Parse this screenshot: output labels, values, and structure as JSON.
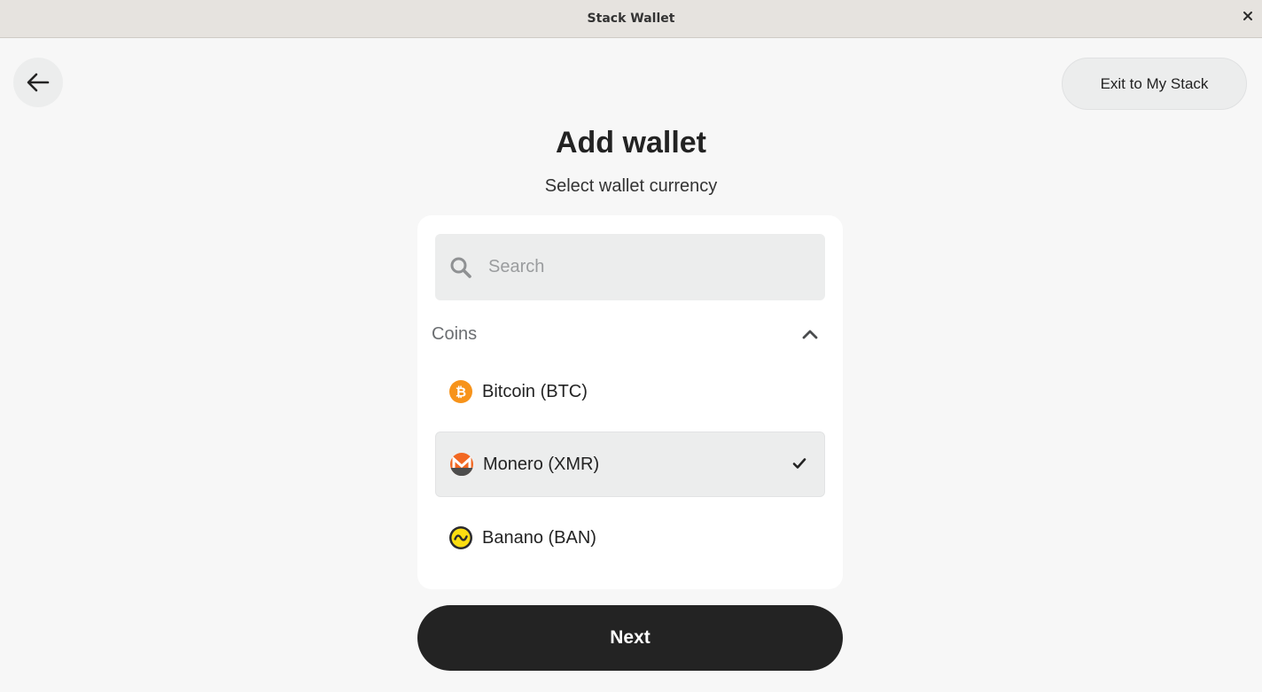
{
  "window": {
    "title": "Stack Wallet",
    "close_icon": "close-icon"
  },
  "header": {
    "back_icon": "arrow-left-icon",
    "exit_label": "Exit to My Stack"
  },
  "main": {
    "title": "Add wallet",
    "subtitle": "Select wallet currency"
  },
  "search": {
    "placeholder": "Search",
    "value": "",
    "icon": "search-icon"
  },
  "coins_section": {
    "label": "Coins",
    "expanded": true,
    "toggle_icon": "chevron-up-icon",
    "items": [
      {
        "name": "Bitcoin (BTC)",
        "icon": "bitcoin-icon",
        "color": "#f7931a",
        "selected": false
      },
      {
        "name": "Monero (XMR)",
        "icon": "monero-icon",
        "color": "#f26822",
        "selected": true
      },
      {
        "name": "Banano (BAN)",
        "icon": "banano-icon",
        "color": "#fbdd11",
        "selected": false
      }
    ]
  },
  "footer": {
    "next_label": "Next"
  },
  "colors": {
    "background": "#f7f7f7",
    "card": "#ffffff",
    "primary_button": "#232323",
    "selected_row": "#eceded"
  }
}
